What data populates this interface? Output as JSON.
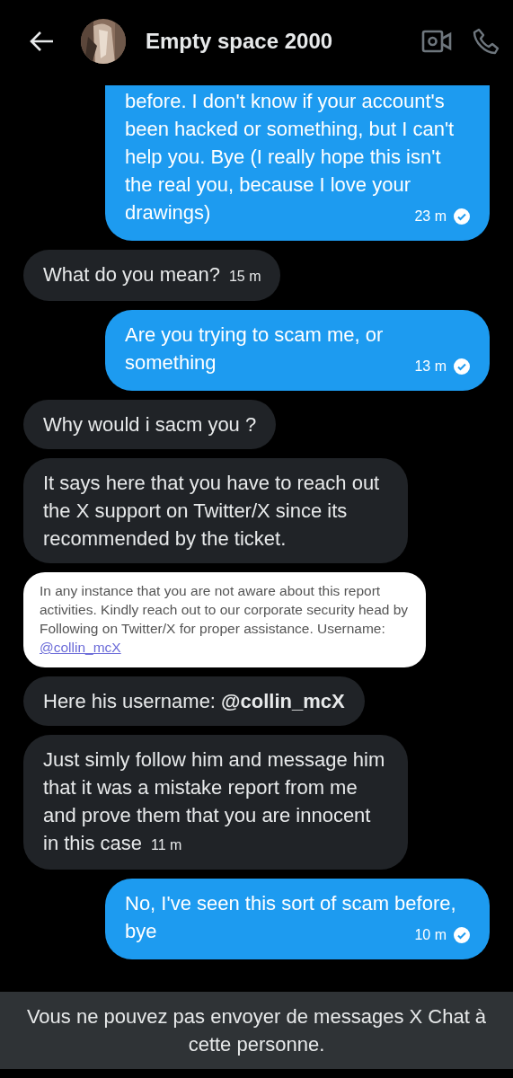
{
  "header": {
    "title": "Empty space 2000"
  },
  "messages": [
    {
      "kind": "sent",
      "text": "before. I don't know if your account's been hacked or something, but I can't help you. Bye (I really hope this isn't the real you, because I love your drawings)",
      "time": "23 m",
      "read": true
    },
    {
      "kind": "received",
      "text": "What do you mean?",
      "time": "15 m"
    },
    {
      "kind": "sent",
      "text": "Are you trying to scam me, or something",
      "time": "13 m",
      "read": true
    },
    {
      "kind": "received",
      "text": "Why would i sacm you ?"
    },
    {
      "kind": "received",
      "text": "It says here that you have to reach out the X support on Twitter/X since its recommended by the ticket."
    },
    {
      "kind": "screenshot",
      "text": "In any instance that you are not aware about this report activities. Kindly reach out to our corporate security head by Following on Twitter/X for proper assistance. Username:",
      "link": "@collin_mcX"
    },
    {
      "kind": "received",
      "text": "Here his username: **@collin_mcX**"
    },
    {
      "kind": "received",
      "text": "Just simly follow him and message him that it was a mistake report from me and prove them that you are innocent in this case",
      "time": "11 m"
    },
    {
      "kind": "sent",
      "text": "No, I've seen this sort of scam before, bye",
      "time": "10 m",
      "read": true
    }
  ],
  "notice": "Vous ne pouvez pas envoyer de messages X Chat à cette personne."
}
